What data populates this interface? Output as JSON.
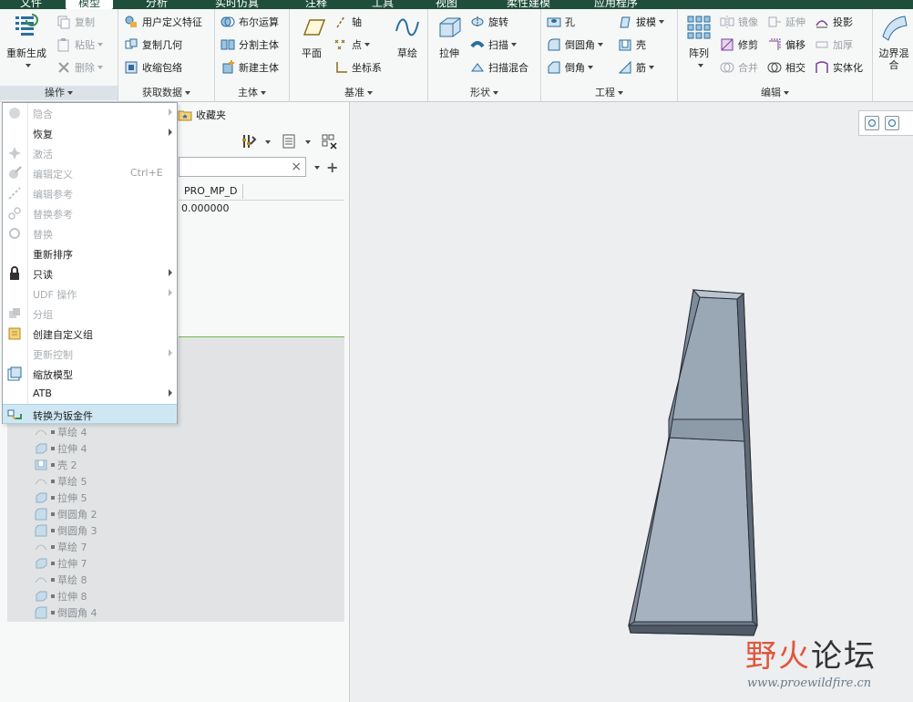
{
  "tabs": [
    {
      "label": "文件",
      "active": false
    },
    {
      "label": "模型",
      "active": true
    },
    {
      "label": "分析",
      "active": false
    },
    {
      "label": "实时仿真",
      "active": false
    },
    {
      "label": "注释",
      "active": false
    },
    {
      "label": "工具",
      "active": false
    },
    {
      "label": "视图",
      "active": false
    },
    {
      "label": "柔性建模",
      "active": false
    },
    {
      "label": "应用程序",
      "active": false
    }
  ],
  "ribbon": {
    "operations": {
      "label": "操作",
      "regenerate": "重新生成",
      "copy": "复制",
      "paste": "粘贴",
      "delete": "删除"
    },
    "get_data": {
      "label": "获取数据",
      "udf": "用户定义特征",
      "copy_geom": "复制几何",
      "shrinkwrap": "收缩包络"
    },
    "body": {
      "label": "主体",
      "boolean": "布尔运算",
      "split": "分割主体",
      "new_body": "新建主体"
    },
    "datum": {
      "label": "基准",
      "plane": "平面",
      "axis": "轴",
      "point": "点",
      "csys": "坐标系",
      "sketch": "草绘"
    },
    "shapes": {
      "label": "形状",
      "extrude": "拉伸",
      "revolve": "旋转",
      "sweep": "扫描",
      "swept_blend": "扫描混合"
    },
    "engineering": {
      "label": "工程",
      "hole": "孔",
      "round": "倒圆角",
      "chamfer": "倒角",
      "draft": "拔模",
      "shell": "壳",
      "rib": "筋"
    },
    "editing": {
      "label": "编辑",
      "pattern": "阵列",
      "mirror": "镜像",
      "extend": "延伸",
      "project": "投影",
      "trim": "修剪",
      "offset": "偏移",
      "thicken": "加厚",
      "merge": "合并",
      "intersect": "相交",
      "solidify": "实体化"
    },
    "surfaces": {
      "boundary_blend": "边界混合"
    }
  },
  "left_panel": {
    "favorites": "收藏夹",
    "filter_clear": "×",
    "add": "+",
    "column_header": "PRO_MP_D",
    "column_value": "0.000000"
  },
  "context_menu": [
    {
      "label": "隐含",
      "disabled": true,
      "submenu": true
    },
    {
      "label": "恢复",
      "disabled": false,
      "submenu": true
    },
    {
      "label": "激活",
      "disabled": true
    },
    {
      "label": "编辑定义",
      "disabled": true,
      "shortcut": "Ctrl+E"
    },
    {
      "label": "编辑参考",
      "disabled": true
    },
    {
      "label": "替换参考",
      "disabled": true
    },
    {
      "label": "替换",
      "disabled": true
    },
    {
      "label": "重新排序",
      "disabled": false
    },
    {
      "label": "只读",
      "disabled": false,
      "submenu": true
    },
    {
      "label": "UDF 操作",
      "disabled": true,
      "submenu": true
    },
    {
      "label": "分组",
      "disabled": true
    },
    {
      "label": "创建自定义组",
      "disabled": false
    },
    {
      "label": "更新控制",
      "disabled": true,
      "submenu": true
    },
    {
      "label": "缩放模型",
      "disabled": false
    },
    {
      "label": "ATB",
      "disabled": false,
      "submenu": true
    },
    {
      "label": "转换为钣金件",
      "disabled": false,
      "highlighted": true
    }
  ],
  "tree_items": [
    {
      "label": "草绘 4",
      "icon": "sketch-icon"
    },
    {
      "label": "拉伸 4",
      "icon": "extrude-icon"
    },
    {
      "label": "壳 2",
      "icon": "shell-icon"
    },
    {
      "label": "草绘 5",
      "icon": "sketch-icon"
    },
    {
      "label": "拉伸 5",
      "icon": "extrude-icon"
    },
    {
      "label": "倒圆角 2",
      "icon": "round-icon"
    },
    {
      "label": "倒圆角 3",
      "icon": "round-icon"
    },
    {
      "label": "草绘 7",
      "icon": "sketch-icon"
    },
    {
      "label": "拉伸 7",
      "icon": "extrude-icon"
    },
    {
      "label": "草绘 8",
      "icon": "sketch-icon"
    },
    {
      "label": "拉伸 8",
      "icon": "extrude-icon"
    },
    {
      "label": "倒圆角 4",
      "icon": "round-icon"
    }
  ],
  "watermark": {
    "left": "野",
    "fire": "火",
    "right": "论坛",
    "url": "www.proewildfire.cn"
  },
  "colors": {
    "accent_dark": "#1f4f3c",
    "highlight": "#cfe7f2",
    "model_face": "#9aa7b5",
    "model_dark": "#6d7b89",
    "watermark_red": "#e0563b"
  }
}
